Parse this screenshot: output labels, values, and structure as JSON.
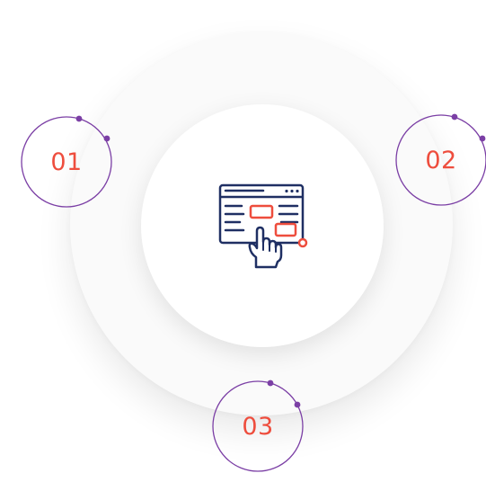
{
  "diagram": {
    "steps": [
      {
        "number": "01"
      },
      {
        "number": "02"
      },
      {
        "number": "03"
      }
    ],
    "center": {
      "icon": "browser-click-icon"
    }
  },
  "colors": {
    "accent": "#ee4d3d",
    "ring": "#7b3fa5",
    "icon_outline": "#1f2f63",
    "outer_circle": "#fafafa",
    "inner_circle": "#ffffff"
  }
}
